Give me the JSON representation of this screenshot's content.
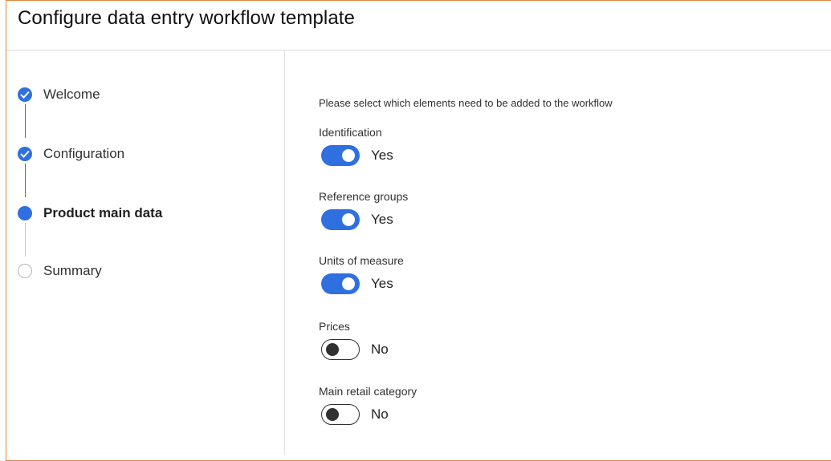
{
  "header": {
    "title": "Configure data entry workflow template"
  },
  "steps": [
    {
      "label": "Welcome",
      "state": "done"
    },
    {
      "label": "Configuration",
      "state": "done"
    },
    {
      "label": "Product main data",
      "state": "current"
    },
    {
      "label": "Summary",
      "state": "pending"
    }
  ],
  "main": {
    "instruction": "Please select which elements need to be added to the workflow",
    "fields": [
      {
        "label": "Identification",
        "value_label": "Yes",
        "on": true
      },
      {
        "label": "Reference groups",
        "value_label": "Yes",
        "on": true
      },
      {
        "label": "Units of measure",
        "value_label": "Yes",
        "on": true
      },
      {
        "label": "Prices",
        "value_label": "No",
        "on": false
      },
      {
        "label": "Main retail category",
        "value_label": "No",
        "on": false
      }
    ]
  },
  "colors": {
    "accent": "#2f6fe0",
    "frame_border": "#e0873a"
  }
}
